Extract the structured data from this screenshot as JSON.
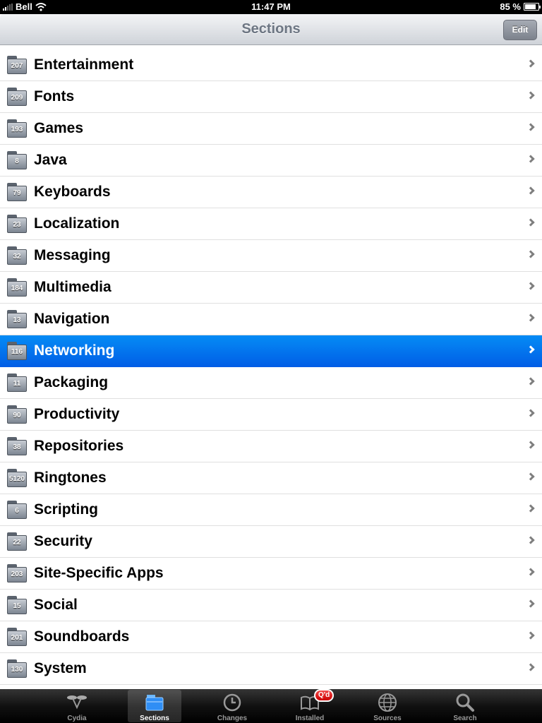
{
  "status_bar": {
    "carrier": "Bell",
    "time": "11:47 PM",
    "battery_percent": "85 %",
    "battery_level": 0.85
  },
  "nav": {
    "title": "Sections",
    "edit_label": "Edit"
  },
  "sections": [
    {
      "count": "207",
      "name": "Entertainment",
      "selected": false
    },
    {
      "count": "209",
      "name": "Fonts",
      "selected": false
    },
    {
      "count": "193",
      "name": "Games",
      "selected": false
    },
    {
      "count": "8",
      "name": "Java",
      "selected": false
    },
    {
      "count": "79",
      "name": "Keyboards",
      "selected": false
    },
    {
      "count": "23",
      "name": "Localization",
      "selected": false
    },
    {
      "count": "32",
      "name": "Messaging",
      "selected": false
    },
    {
      "count": "184",
      "name": "Multimedia",
      "selected": false
    },
    {
      "count": "13",
      "name": "Navigation",
      "selected": false
    },
    {
      "count": "116",
      "name": "Networking",
      "selected": true
    },
    {
      "count": "11",
      "name": "Packaging",
      "selected": false
    },
    {
      "count": "90",
      "name": "Productivity",
      "selected": false
    },
    {
      "count": "38",
      "name": "Repositories",
      "selected": false
    },
    {
      "count": "5120",
      "name": "Ringtones",
      "selected": false
    },
    {
      "count": "6",
      "name": "Scripting",
      "selected": false
    },
    {
      "count": "22",
      "name": "Security",
      "selected": false
    },
    {
      "count": "203",
      "name": "Site-Specific Apps",
      "selected": false
    },
    {
      "count": "15",
      "name": "Social",
      "selected": false
    },
    {
      "count": "201",
      "name": "Soundboards",
      "selected": false
    },
    {
      "count": "130",
      "name": "System",
      "selected": false
    }
  ],
  "tabs": [
    {
      "label": "Cydia",
      "icon": "cydia-icon",
      "active": false
    },
    {
      "label": "Sections",
      "icon": "sections-icon",
      "active": true
    },
    {
      "label": "Changes",
      "icon": "clock-icon",
      "active": false
    },
    {
      "label": "Installed",
      "icon": "book-icon",
      "active": false,
      "badge": "Q'd"
    },
    {
      "label": "Sources",
      "icon": "globe-icon",
      "active": false
    },
    {
      "label": "Search",
      "icon": "magnifier-icon",
      "active": false
    }
  ],
  "colors": {
    "selection_top": "#058cf5",
    "selection_bottom": "#015ee6",
    "nav_title": "#6d7683",
    "badge": "#d40000"
  }
}
